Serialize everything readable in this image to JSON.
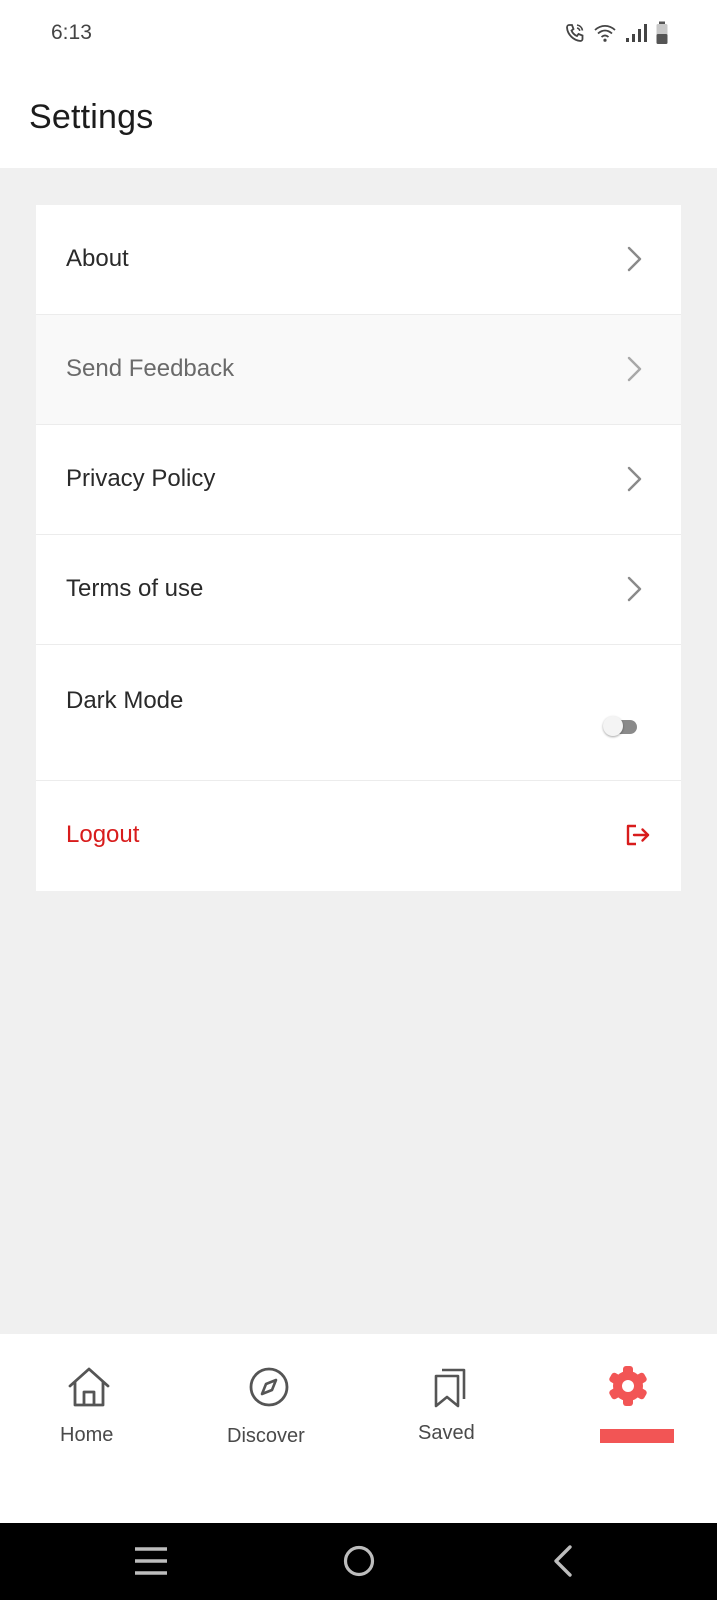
{
  "status_bar": {
    "time": "6:13",
    "icons": [
      "call-icon",
      "wifi-icon",
      "signal-icon",
      "battery-icon"
    ]
  },
  "header": {
    "title": "Settings"
  },
  "settings": {
    "items": [
      {
        "label": "About",
        "icon": "chevron-right-icon"
      },
      {
        "label": "Send Feedback",
        "icon": "chevron-right-icon"
      },
      {
        "label": "Privacy Policy",
        "icon": "chevron-right-icon"
      },
      {
        "label": "Terms of use",
        "icon": "chevron-right-icon"
      }
    ],
    "dark_mode": {
      "label": "Dark Mode",
      "enabled": false
    },
    "logout": {
      "label": "Logout",
      "icon": "logout-icon"
    }
  },
  "bottom_nav": {
    "items": [
      {
        "label": "Home",
        "icon": "home-icon"
      },
      {
        "label": "Discover",
        "icon": "compass-icon"
      },
      {
        "label": "Saved",
        "icon": "bookmarks-icon"
      },
      {
        "label": "",
        "icon": "gear-icon",
        "active": true
      }
    ]
  },
  "system_nav": {
    "buttons": [
      "recents-icon",
      "home-circle-icon",
      "back-icon"
    ]
  },
  "colors": {
    "accent": "#f25555",
    "danger_text": "#d81c1c",
    "background": "#f0f0f0",
    "card": "#ffffff",
    "icon_gray": "#555555"
  }
}
